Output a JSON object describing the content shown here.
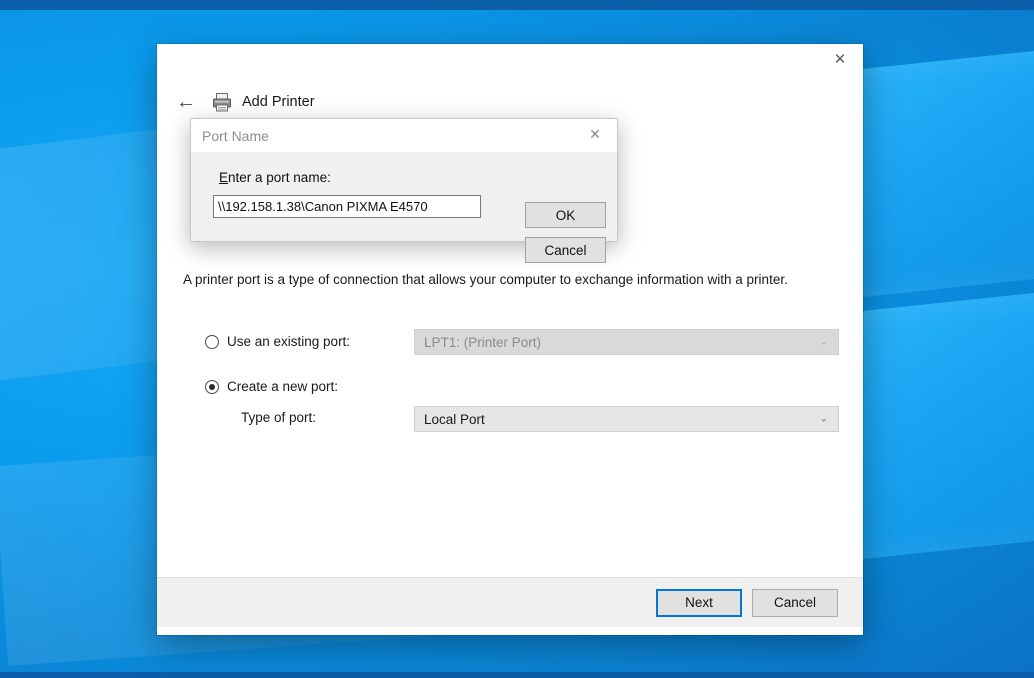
{
  "desktop": {
    "wallpaper_name": "windows-10-hero-wallpaper",
    "colors": {
      "wallpaper_primary": "#0b9bed",
      "wallpaper_deep": "#0a5fa8",
      "pane_light": "#2bb6fb",
      "accent": "#0078d7"
    }
  },
  "window": {
    "title": "Add Printer",
    "printer_icon": "printer-icon",
    "back_icon": "back-arrow-icon",
    "close_icon": "close-icon",
    "close_label": "✕",
    "back_label": "←",
    "intro_text": "A printer port is a type of connection that allows your computer to exchange information with a printer.",
    "fields": {
      "existing_port": {
        "radio_label": "Use an existing port:",
        "selected": false,
        "value": "LPT1: (Printer Port)",
        "enabled": false,
        "chevron": "⌄"
      },
      "new_port": {
        "radio_label": "Create a new port:",
        "selected": true
      },
      "type_of_port": {
        "label": "Type of port:",
        "value": "Local Port",
        "enabled": true,
        "chevron": "⌄"
      }
    },
    "footer": {
      "next_label": "Next",
      "cancel_label": "Cancel",
      "default_button": "Next"
    }
  },
  "dialog": {
    "title": "Port Name",
    "close_icon": "close-icon",
    "close_label": "✕",
    "field_label_accesskey": "E",
    "field_label_rest": "nter a port name:",
    "port_name_value": "\\\\192.158.1.38\\Canon PIXMA E4570",
    "port_name_placeholder": "",
    "ok_label": "OK",
    "cancel_label": "Cancel"
  }
}
